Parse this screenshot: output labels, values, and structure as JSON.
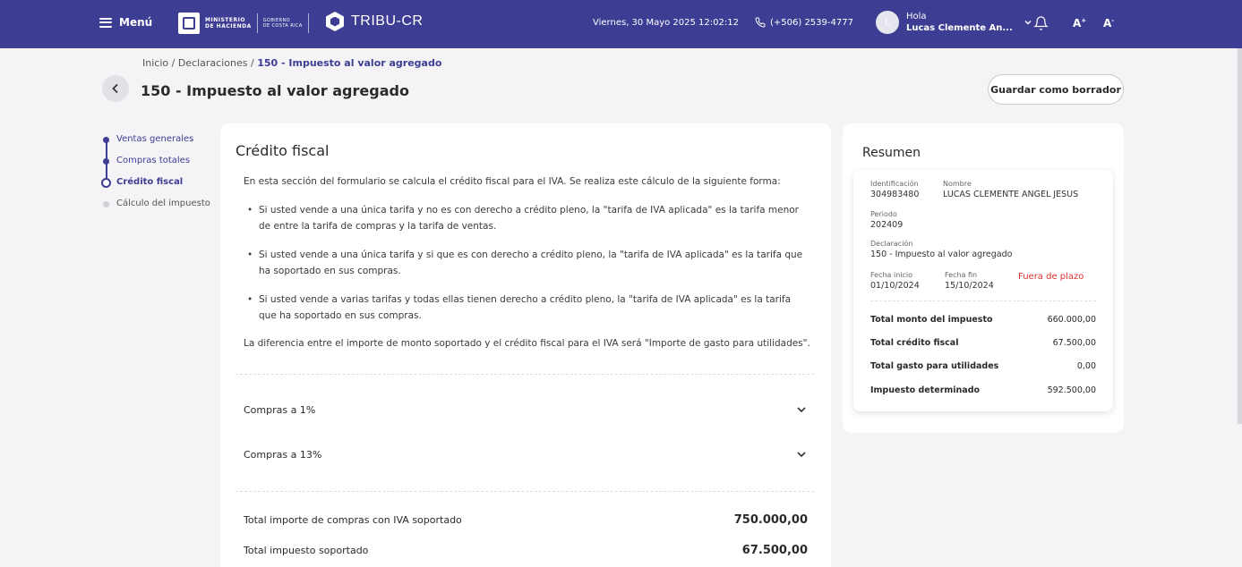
{
  "header": {
    "menu_label": "Menú",
    "ministry_line1": "MINISTERIO",
    "ministry_line2": "DE HACIENDA",
    "gov_line1": "GOBIERNO",
    "gov_line2": "DE COSTA RICA",
    "app_name": "TRIBU-CR",
    "datetime": "Viernes, 30 Mayo 2025 12:02:12",
    "phone": "(+506) 2539-4777",
    "greeting": "Hola",
    "user_name": "Lucas Clemente An...",
    "avatar_initial": "L",
    "font_increase": "A",
    "font_decrease": "A",
    "font_increase_sign": "+",
    "font_decrease_sign": "-"
  },
  "breadcrumb": {
    "home": "Inicio",
    "sep": "/",
    "section": "Declaraciones",
    "current": "150 - Impuesto al valor agregado"
  },
  "page": {
    "title": "150 - Impuesto al valor agregado",
    "draft_button": "Guardar como borrador"
  },
  "stepper": {
    "steps": [
      {
        "label": "Ventas generales",
        "state": "done"
      },
      {
        "label": "Compras totales",
        "state": "done"
      },
      {
        "label": "Crédito fiscal",
        "state": "active"
      },
      {
        "label": "Cálculo del impuesto",
        "state": "todo"
      }
    ]
  },
  "credito": {
    "title": "Crédito fiscal",
    "intro": "En esta sección del formulario se calcula el crédito fiscal para el IVA. Se realiza este cálculo de la siguiente forma:",
    "bullets": [
      "Si usted vende a una única tarifa y no es con derecho a crédito pleno, la \"tarifa de IVA aplicada\" es la tarifa menor de entre la tarifa de compras y la tarifa de ventas.",
      "Si usted vende a una única tarifa y si que es con derecho a crédito pleno, la \"tarifa de IVA aplicada\" es la tarifa que ha soportado en sus compras.",
      "Si usted vende a varias tarifas y todas ellas tienen derecho a crédito pleno, la \"tarifa de IVA aplicada\" es la tarifa que ha soportado en sus compras."
    ],
    "difference_note": "La diferencia entre el importe de monto soportado y el crédito fiscal para el IVA será \"Importe de gasto para utilidades\".",
    "accordions": [
      {
        "label": "Compras a 1%"
      },
      {
        "label": "Compras a 13%"
      }
    ],
    "totals": [
      {
        "label": "Total importe de compras con IVA soportado",
        "value": "750.000,00"
      },
      {
        "label": "Total impuesto soportado",
        "value": "67.500,00"
      }
    ]
  },
  "resumen": {
    "title": "Resumen",
    "identificacion_label": "Identificación",
    "identificacion": "304983480",
    "nombre_label": "Nombre",
    "nombre": "LUCAS CLEMENTE ANGEL JESUS",
    "periodo_label": "Periodo",
    "periodo": "202409",
    "declaracion_label": "Declaración",
    "declaracion": "150 - Impuesto al valor agregado",
    "fecha_inicio_label": "Fecha inicio",
    "fecha_inicio": "01/10/2024",
    "fecha_fin_label": "Fecha fin",
    "fecha_fin": "15/10/2024",
    "status": "Fuera de plazo",
    "rows": [
      {
        "label": "Total monto del impuesto",
        "value": "660.000,00"
      },
      {
        "label": "Total crédito fiscal",
        "value": "67.500,00"
      },
      {
        "label": "Total gasto para utilidades",
        "value": "0,00"
      },
      {
        "label": "Impuesto determinado",
        "value": "592.500,00"
      }
    ]
  },
  "colors": {
    "brand": "#3d3d94",
    "late_status": "#d93030"
  }
}
